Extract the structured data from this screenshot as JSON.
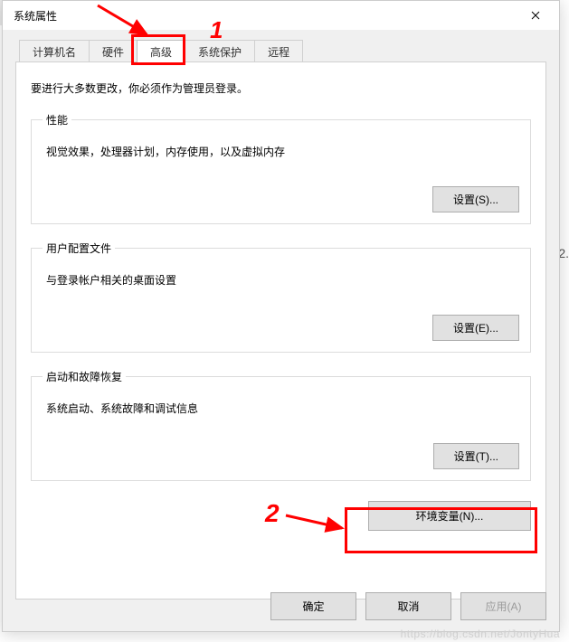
{
  "window": {
    "title": "系统属性"
  },
  "tabs": [
    "计算机名",
    "硬件",
    "高级",
    "系统保护",
    "远程"
  ],
  "activeTabIndex": 2,
  "intro": "要进行大多数更改，你必须作为管理员登录。",
  "groups": {
    "performance": {
      "legend": "性能",
      "desc": "视觉效果，处理器计划，内存使用，以及虚拟内存",
      "button": "设置(S)..."
    },
    "userProfiles": {
      "legend": "用户配置文件",
      "desc": "与登录帐户相关的桌面设置",
      "button": "设置(E)..."
    },
    "startup": {
      "legend": "启动和故障恢复",
      "desc": "系统启动、系统故障和调试信息",
      "button": "设置(T)..."
    }
  },
  "envButton": "环境变量(N)...",
  "dialogButtons": {
    "ok": "确定",
    "cancel": "取消",
    "apply": "应用(A)"
  },
  "annotations": {
    "num1": "1",
    "num2": "2"
  },
  "watermark": "https://blog.csdn.net/JontyHua",
  "edgeText": "2."
}
